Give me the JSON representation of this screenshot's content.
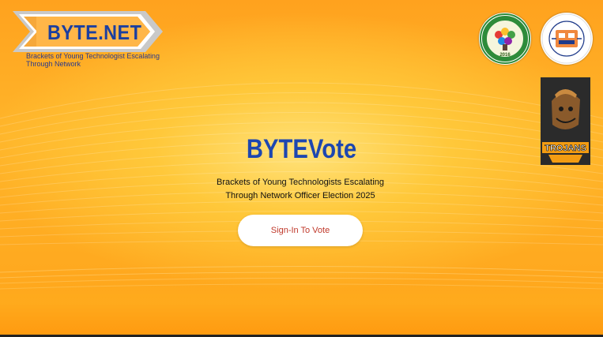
{
  "header": {
    "brand_title": "BYTE.NET",
    "brand_subtitle": "Brackets of Young Technologist Escalating\nThrough Network"
  },
  "logos": {
    "school_year": "2016",
    "team_name": "TROJANS"
  },
  "hero": {
    "title": "BYTEVote",
    "subtitle": "Brackets of Young Technologists  Escalating\nThrough Network Officer Election 2025",
    "signin_label": "Sign-In To Vote"
  },
  "colors": {
    "accent": "#1d47b0",
    "button_text": "#c0392b",
    "background": "#ffb52a"
  }
}
